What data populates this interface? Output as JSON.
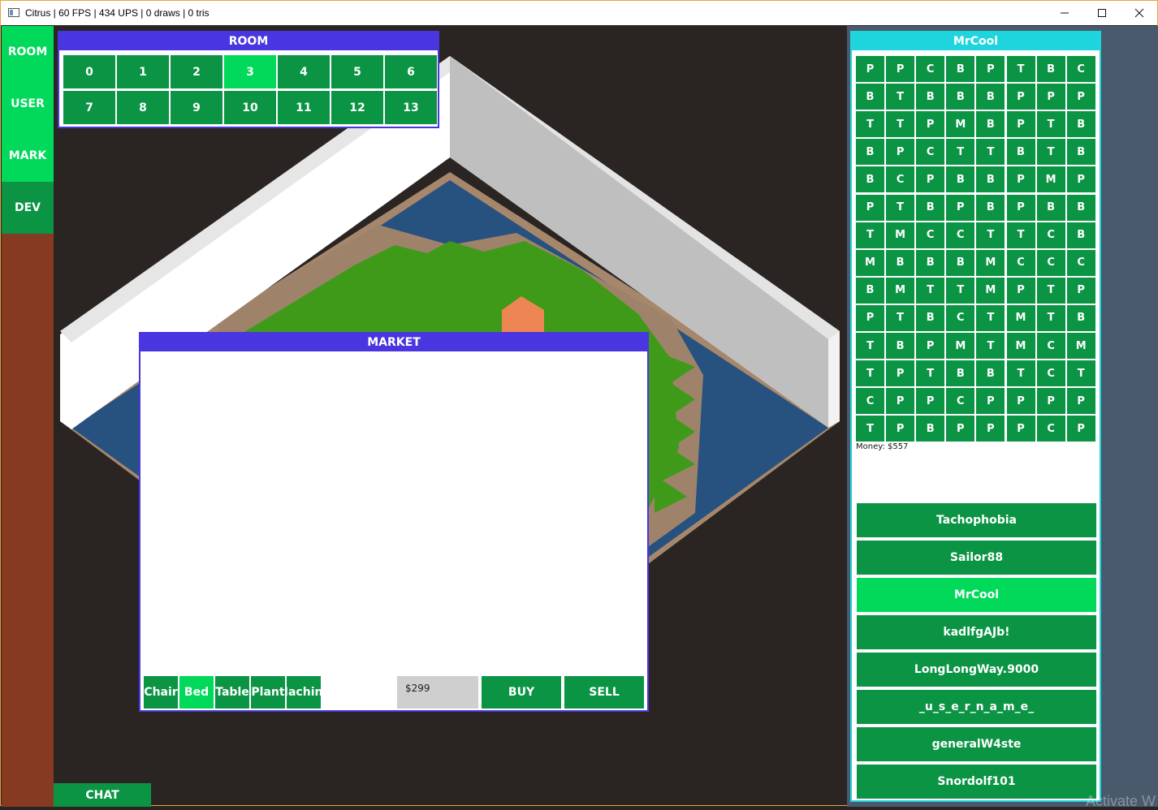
{
  "window": {
    "title": "Citrus | 60 FPS | 434 UPS | 0 draws | 0 tris",
    "minimize_icon": "minimize-icon",
    "maximize_icon": "maximize-icon",
    "close_icon": "close-icon"
  },
  "nav": {
    "items": [
      {
        "label": "ROOM"
      },
      {
        "label": "USER"
      },
      {
        "label": "MARK"
      },
      {
        "label": "DEV"
      }
    ]
  },
  "room": {
    "title": "ROOM",
    "buttons": [
      "0",
      "1",
      "2",
      "3",
      "4",
      "5",
      "6",
      "7",
      "8",
      "9",
      "10",
      "11",
      "12",
      "13"
    ],
    "active": "3"
  },
  "market": {
    "title": "MARKET",
    "categories": [
      {
        "label": "Chair"
      },
      {
        "label": "Bed"
      },
      {
        "label": "Table"
      },
      {
        "label": "Plant"
      },
      {
        "label": "Machine"
      }
    ],
    "active_category": "Bed",
    "price": "$299",
    "buy_label": "BUY",
    "sell_label": "SELL"
  },
  "user_panel": {
    "title": "MrCool",
    "inventory": [
      [
        "P",
        "P",
        "C",
        "B",
        "P",
        "T",
        "B",
        "C"
      ],
      [
        "B",
        "T",
        "B",
        "B",
        "B",
        "P",
        "P",
        "P"
      ],
      [
        "T",
        "T",
        "P",
        "M",
        "B",
        "P",
        "T",
        "B"
      ],
      [
        "B",
        "P",
        "C",
        "T",
        "T",
        "B",
        "T",
        "B"
      ],
      [
        "B",
        "C",
        "P",
        "B",
        "B",
        "P",
        "M",
        "P"
      ],
      [
        "P",
        "T",
        "B",
        "P",
        "B",
        "P",
        "B",
        "B"
      ],
      [
        "T",
        "M",
        "C",
        "C",
        "T",
        "T",
        "C",
        "B"
      ],
      [
        "M",
        "B",
        "B",
        "B",
        "M",
        "C",
        "C",
        "C"
      ],
      [
        "B",
        "M",
        "T",
        "T",
        "M",
        "P",
        "T",
        "P"
      ],
      [
        "P",
        "T",
        "B",
        "C",
        "T",
        "M",
        "T",
        "B"
      ],
      [
        "T",
        "B",
        "P",
        "M",
        "T",
        "M",
        "C",
        "M"
      ],
      [
        "T",
        "P",
        "T",
        "B",
        "B",
        "T",
        "C",
        "T"
      ],
      [
        "C",
        "P",
        "P",
        "C",
        "P",
        "P",
        "P",
        "P"
      ],
      [
        "T",
        "P",
        "B",
        "P",
        "P",
        "P",
        "C",
        "P"
      ]
    ],
    "money": "Money: $557",
    "users": [
      {
        "name": "Tachophobia"
      },
      {
        "name": "Sailor88"
      },
      {
        "name": "MrCool"
      },
      {
        "name": "kadlfgAJb!"
      },
      {
        "name": "LongLongWay.9000"
      },
      {
        "name": "_u_s_e_r_n_a_m_e_"
      },
      {
        "name": "generalW4ste"
      },
      {
        "name": "Snordolf101"
      }
    ],
    "active_user": "MrCool"
  },
  "chat": {
    "label": "CHAT"
  },
  "watermark": "Activate W",
  "colors": {
    "accent_green": "#0b9444",
    "active_green": "#00d95a",
    "panel_purple": "#4a36e0",
    "panel_cyan": "#1fd5dd",
    "nav_brown": "#873a22"
  }
}
